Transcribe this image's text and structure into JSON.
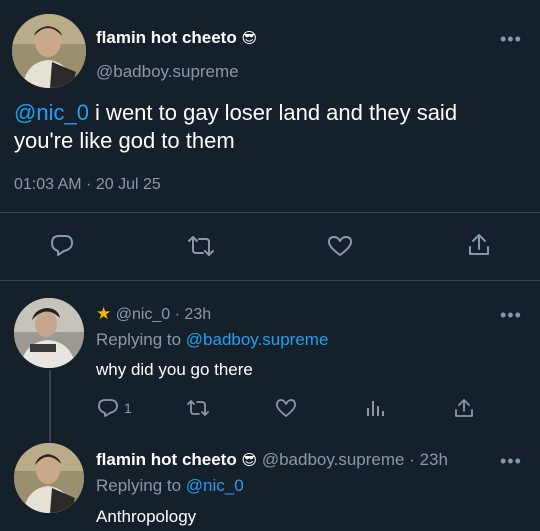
{
  "main_tweet": {
    "author_name": "flamin hot cheeto",
    "author_emoji": "😎",
    "author_handle": "@badboy.supreme",
    "mention": "@nic_0",
    "text_line1_rest": " i went to gay loser land and they said",
    "text_line2": "you're like god to them",
    "timestamp": "01:03 AM · 20 Jul 25",
    "actions": [
      "reply-icon",
      "retweet-icon",
      "like-icon",
      "share-icon"
    ]
  },
  "reply_1": {
    "star": "★",
    "author_handle": "@nic_0",
    "time": " · 23h",
    "replying_prefix": "Replying to ",
    "replying_to": "@badboy.supreme",
    "text": "why did you go there",
    "reply_count": "1",
    "actions": [
      "reply-icon",
      "retweet-icon",
      "like-icon",
      "analytics-icon",
      "share-icon"
    ]
  },
  "reply_2": {
    "author_name": "flamin hot cheeto",
    "author_emoji": "😎",
    "author_handle": "@badboy.supreme",
    "time": " · 23h",
    "replying_prefix": "Replying to ",
    "replying_to": "@nic_0",
    "text": "Anthropology"
  },
  "colors": {
    "background": "#15202b",
    "text": "#ffffff",
    "muted": "#8899a6",
    "link": "#1da1f2",
    "divider": "#38444d"
  }
}
